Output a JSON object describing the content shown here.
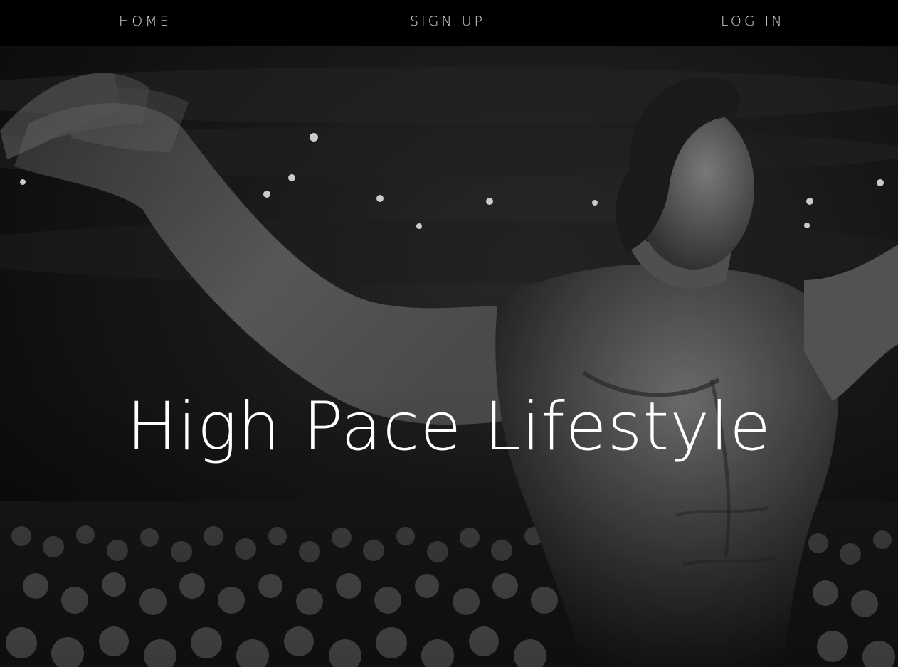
{
  "nav": {
    "home_label": "HOME",
    "signup_label": "SIGN UP",
    "login_label": "LOG IN"
  },
  "hero": {
    "title": "High Pace Lifestyle",
    "image_subject": "black-and-white photo of a bodybuilder posing on stage before a crowd"
  },
  "colors": {
    "nav_background": "#000000",
    "nav_text": "#d8d8d8",
    "title_text": "#ffffff"
  }
}
